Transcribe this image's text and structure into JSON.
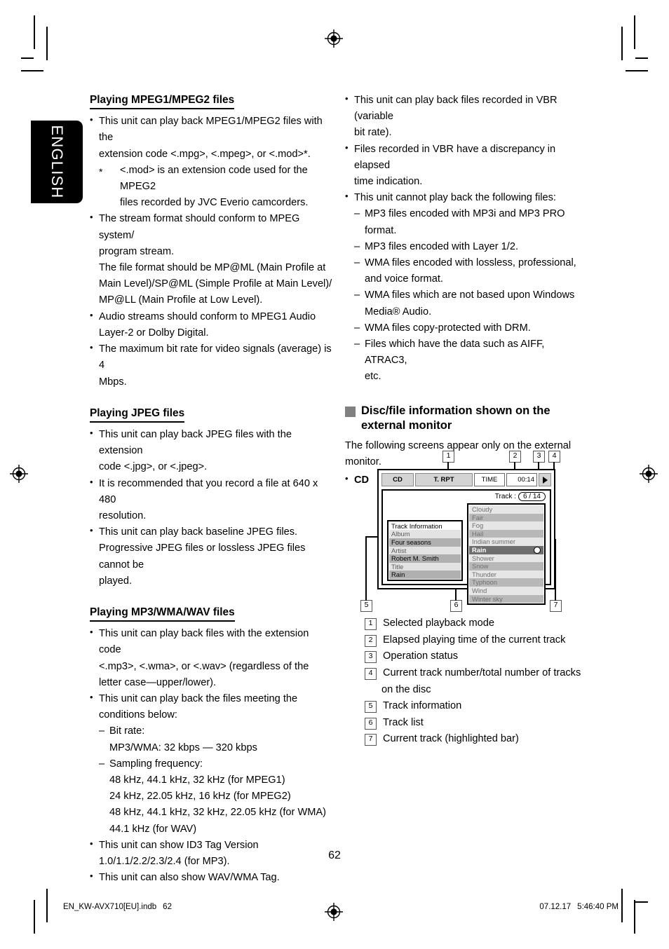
{
  "page": {
    "language_tab": "ENGLISH",
    "page_number": "62",
    "footer_left_file": "EN_KW-AVX710[EU].indb",
    "footer_left_page": "62",
    "footer_right_date": "07.12.17",
    "footer_right_time": "5:46:40 PM"
  },
  "left_column": {
    "section_mpeg": {
      "heading": "Playing MPEG1/MPEG2 files",
      "bullets": [
        {
          "lines": [
            "This unit can play back MPEG1/MPEG2 files with the",
            "extension code <.mpg>, <.mpeg>, or <.mod>*."
          ],
          "note_lines": [
            "<.mod> is an extension code used for the MPEG2",
            "files recorded by JVC Everio camcorders."
          ]
        },
        {
          "lines": [
            "The stream format should conform to MPEG system/",
            "program stream.",
            "The file format should be MP@ML (Main Profile at",
            "Main Level)/SP@ML (Simple Profile at Main Level)/",
            "MP@LL (Main Profile at Low Level)."
          ]
        },
        {
          "lines": [
            "Audio streams should conform to MPEG1 Audio",
            "Layer-2 or Dolby Digital."
          ]
        },
        {
          "lines": [
            "The maximum bit rate for video signals (average) is 4",
            "Mbps."
          ]
        }
      ]
    },
    "section_jpeg": {
      "heading": "Playing JPEG files",
      "bullets": [
        {
          "lines": [
            "This unit can play back JPEG files with the extension",
            "code <.jpg>, or <.jpeg>."
          ]
        },
        {
          "lines": [
            "It is recommended that you record a file at 640 x 480",
            "resolution."
          ]
        },
        {
          "lines": [
            "This unit can play back baseline JPEG files.",
            "Progressive JPEG files or lossless JPEG files cannot be",
            "played."
          ]
        }
      ]
    },
    "section_mp3": {
      "heading": "Playing MP3/WMA/WAV files",
      "bullets": [
        {
          "lines": [
            "This unit can play back files with the extension code",
            "<.mp3>, <.wma>, or <.wav> (regardless of the",
            "letter case—upper/lower)."
          ]
        },
        {
          "lines": [
            "This unit can play back the files meeting the",
            "conditions below:"
          ],
          "sub": [
            {
              "dash": "Bit rate:",
              "indented": [
                "MP3/WMA: 32 kbps — 320 kbps"
              ]
            },
            {
              "dash": "Sampling frequency:",
              "indented": [
                "48 kHz, 44.1 kHz, 32 kHz (for MPEG1)",
                "24 kHz, 22.05 kHz, 16 kHz (for MPEG2)",
                "48 kHz, 44.1 kHz, 32 kHz, 22.05 kHz (for WMA)",
                "44.1 kHz (for WAV)"
              ]
            }
          ]
        },
        {
          "lines": [
            "This unit can show ID3 Tag Version",
            "1.0/1.1/2.2/2.3/2.4 (for MP3)."
          ]
        },
        {
          "lines": [
            "This unit can also show WAV/WMA Tag."
          ]
        }
      ]
    }
  },
  "right_column": {
    "bullets": [
      {
        "lines": [
          "This unit can play back files recorded in VBR (variable",
          "bit rate)."
        ]
      },
      {
        "lines": [
          "Files recorded in VBR have a discrepancy in elapsed",
          "time indication."
        ]
      },
      {
        "lines": [
          "This unit cannot play back the following files:"
        ],
        "sub": [
          {
            "dash": "MP3 files encoded with MP3i and MP3 PRO",
            "cont": [
              "format."
            ]
          },
          {
            "dash": "MP3 files encoded with Layer 1/2.",
            "cont": []
          },
          {
            "dash": "WMA files encoded with lossless, professional,",
            "cont": [
              "and voice format."
            ]
          },
          {
            "dash": "WMA files which are not based upon Windows",
            "cont": [
              "Media® Audio."
            ]
          },
          {
            "dash": "WMA files copy-protected with DRM.",
            "cont": []
          },
          {
            "dash": "Files which have the data such as AIFF, ATRAC3,",
            "cont": [
              "etc."
            ]
          }
        ]
      }
    ],
    "disc_info_heading_line1": "Disc/file information shown on the",
    "disc_info_heading_line2": "external monitor",
    "intro_line1": "The following screens appear only on the external",
    "intro_line2": "monitor.",
    "cd_label": "CD"
  },
  "diagram": {
    "status_bar": {
      "source": "CD",
      "mode": "T. RPT",
      "time_label": "TIME",
      "time_value": "00:14",
      "operation_icon": "play-icon"
    },
    "track_counter": {
      "label": "Track :",
      "value": "6 / 14"
    },
    "track_information": {
      "title": "Track Information",
      "rows": [
        {
          "label": "Album",
          "value": "Four seasons"
        },
        {
          "label": "Artist",
          "value": "Robert M. Smith"
        },
        {
          "label": "Title",
          "value": "Rain"
        }
      ]
    },
    "track_list": [
      "Cloudy",
      "Fair",
      "Fog",
      "Hail",
      "Indian summer",
      "Rain",
      "Shower",
      "Snow",
      "Thunder",
      "Typhoon",
      "Wind",
      "Winter sky"
    ],
    "selected_track": "Rain",
    "callout_numbers": [
      "1",
      "2",
      "3",
      "4",
      "5",
      "6",
      "7"
    ]
  },
  "legend": [
    {
      "num": "1",
      "text": "Selected playback mode",
      "cont": ""
    },
    {
      "num": "2",
      "text": "Elapsed playing time of the current track",
      "cont": ""
    },
    {
      "num": "3",
      "text": "Operation status",
      "cont": ""
    },
    {
      "num": "4",
      "text": "Current track number/total number of tracks",
      "cont": "on the disc"
    },
    {
      "num": "5",
      "text": "Track information",
      "cont": ""
    },
    {
      "num": "6",
      "text": "Track list",
      "cont": ""
    },
    {
      "num": "7",
      "text": "Current track (highlighted bar)",
      "cont": ""
    }
  ]
}
